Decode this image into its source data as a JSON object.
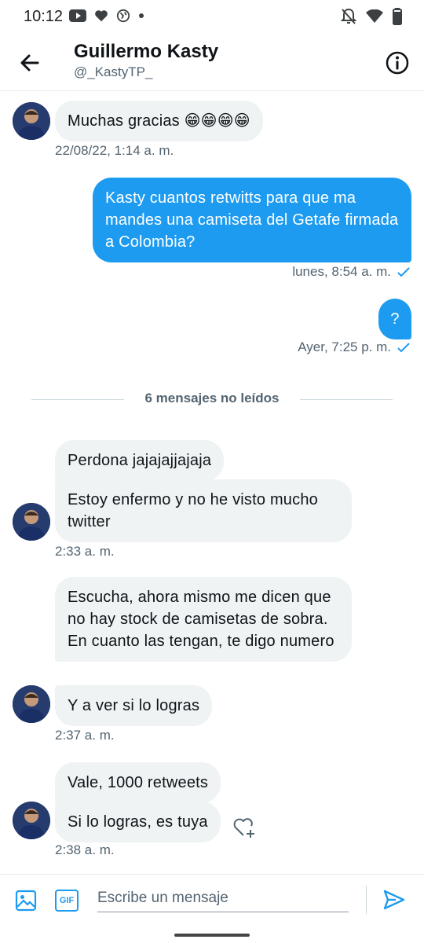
{
  "status_bar": {
    "time": "10:12"
  },
  "header": {
    "name": "Guillermo Kasty",
    "handle": "@_KastyTP_"
  },
  "messages": {
    "m1": {
      "text": "Muchas gracias 😁😁😁😁",
      "time": "22/08/22, 1:14 a. m."
    },
    "m2": {
      "text": "Kasty cuantos retwitts para que ma mandes una camiseta del Getafe firmada a Colombia?",
      "time": "lunes, 8:54 a. m."
    },
    "m3": {
      "text": "?",
      "time": "Ayer, 7:25 p. m."
    },
    "unread_divider": "6 mensajes no leídos",
    "m4": {
      "text": "Perdona jajajajjajaja"
    },
    "m5": {
      "text": "Estoy enfermo y no he visto mucho twitter",
      "time": "2:33 a. m."
    },
    "m6": {
      "text": "Escucha, ahora mismo me dicen que no hay stock de camisetas de sobra. En cuanto las tengan, te digo numero"
    },
    "m7": {
      "text": "Y a ver si lo logras",
      "time": "2:37 a. m."
    },
    "m8": {
      "text": "Vale, 1000 retweets"
    },
    "m9": {
      "text": "Si lo logras, es tuya",
      "time": "2:38 a. m."
    }
  },
  "composer": {
    "placeholder": "Escribe un mensaje",
    "gif_label": "GIF"
  },
  "colors": {
    "accent": "#1d9bf0",
    "incoming_bubble": "#eff3f4",
    "secondary_text": "#536471"
  },
  "icons": [
    "back-arrow-icon",
    "info-icon",
    "image-icon",
    "gif-icon",
    "send-icon",
    "heart-plus-icon",
    "checkmark-icon"
  ]
}
